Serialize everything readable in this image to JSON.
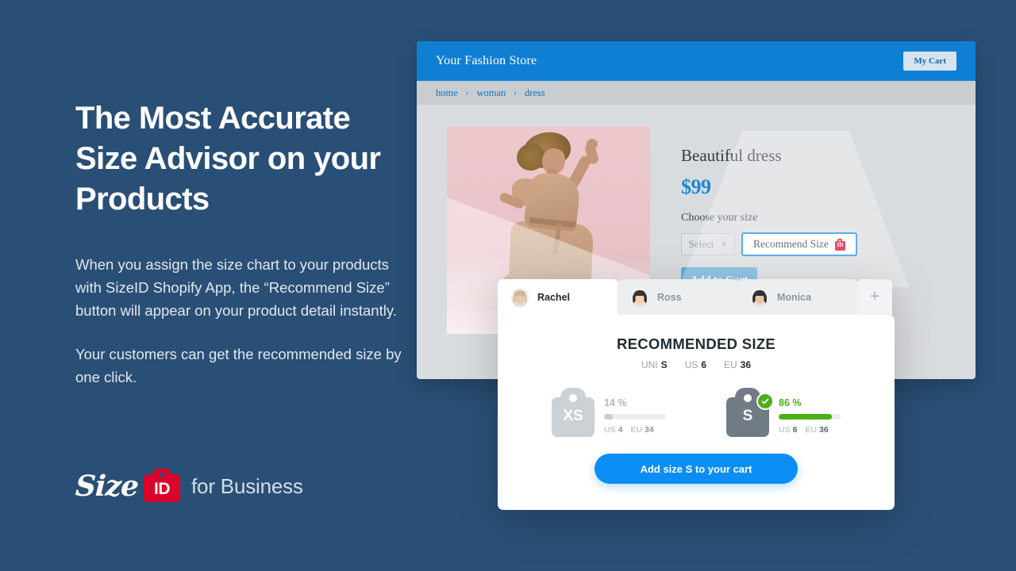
{
  "marketing": {
    "headline": "The Most Accurate Size Advisor on your Products",
    "paragraph1": "When you assign the size chart to your products with SizeID Shopify App, the “Recommend Size” button will appear on your product detail instantly.",
    "paragraph2": "Your customers can get the recommended size by one click.",
    "logo": {
      "word": "Size",
      "tag": "ID",
      "suffix": "for Business"
    }
  },
  "store": {
    "name": "Your Fashion Store",
    "cart_button": "My Cart",
    "breadcrumbs": [
      "home",
      "woman",
      "dress"
    ],
    "breadcrumb_separator": "›",
    "product": {
      "title": "Beautiful dress",
      "price": "$99",
      "size_label": "Choose your size",
      "select_placeholder": "Select",
      "recommend_button": "Recommend Size",
      "recommend_icon_text": "ID",
      "add_to_cart": "Add to Cart"
    }
  },
  "panel": {
    "tabs": [
      {
        "name": "Rachel",
        "active": true
      },
      {
        "name": "Ross",
        "active": false
      },
      {
        "name": "Monica",
        "active": false
      }
    ],
    "add_tab_label": "+",
    "title": "RECOMMENDED SIZE",
    "summary": [
      {
        "label": "UNI",
        "value": "S"
      },
      {
        "label": "US",
        "value": "6"
      },
      {
        "label": "EU",
        "value": "36"
      }
    ],
    "options": [
      {
        "size": "XS",
        "percent": "14 %",
        "percent_value": 14,
        "selected": false,
        "conversions": [
          {
            "label": "US",
            "value": "4"
          },
          {
            "label": "EU",
            "value": "34"
          }
        ]
      },
      {
        "size": "S",
        "percent": "86 %",
        "percent_value": 86,
        "selected": true,
        "conversions": [
          {
            "label": "US",
            "value": "6"
          },
          {
            "label": "EU",
            "value": "36"
          }
        ]
      }
    ],
    "cta": "Add size S to your cart"
  },
  "colors": {
    "page_background": "#2a4f76",
    "store_header_blue": "#0f7fd4",
    "price_blue": "#1d87d0",
    "accent_blue": "#0a8ef4",
    "recommend_border": "#1c8ae0",
    "brand_red": "#d8042b",
    "success_green": "#4caf19",
    "muted_grey": "#aeb5bc"
  }
}
